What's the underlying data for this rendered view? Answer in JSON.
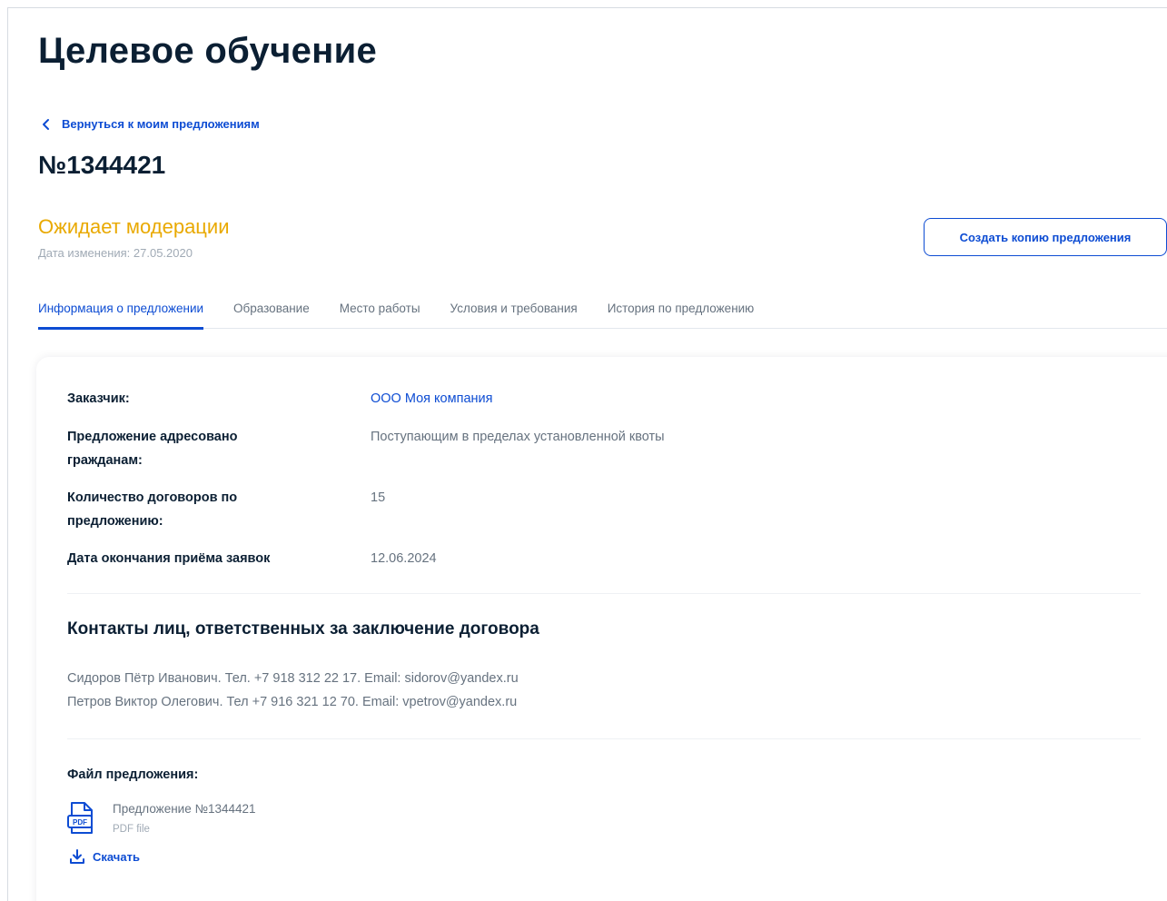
{
  "page": {
    "title": "Целевое обучение",
    "back_link": "Вернуться к моим предложениям",
    "offer_number": "№1344421",
    "status": "Ожидает модерации",
    "changed_date": "Дата изменения: 27.05.2020",
    "copy_button": "Создать копию предложения"
  },
  "tabs": [
    {
      "label": "Информация о предложении",
      "active": true
    },
    {
      "label": "Образование",
      "active": false
    },
    {
      "label": "Место работы",
      "active": false
    },
    {
      "label": "Условия и требования",
      "active": false
    },
    {
      "label": "История по предложению",
      "active": false
    }
  ],
  "info": {
    "customer_label": "Заказчик:",
    "customer_value": "ООО Моя компания",
    "addressed_label": "Предложение адресовано гражданам:",
    "addressed_value": "Поступающим в пределах установленной квоты",
    "contracts_label": "Количество договоров по предложению:",
    "contracts_value": "15",
    "deadline_label": "Дата окончания приёма заявок",
    "deadline_value": "12.06.2024"
  },
  "contacts": {
    "title": "Контакты лиц, ответственных за заключение договора",
    "lines": [
      "Сидоров Пётр Иванович. Тел. +7 918 312 22 17. Email: sidorov@yandex.ru",
      "Петров Виктор Олегович. Тел +7 916 321 12 70. Email: vpetrov@yandex.ru"
    ]
  },
  "file": {
    "title": "Файл предложения:",
    "name": "Предложение №1344421",
    "type": "PDF file",
    "icon_text": "PDF",
    "download_label": "Скачать"
  },
  "colors": {
    "accent": "#0d4cd3",
    "status": "#e9a900",
    "text": "#0b1f33",
    "muted": "#66727f"
  }
}
